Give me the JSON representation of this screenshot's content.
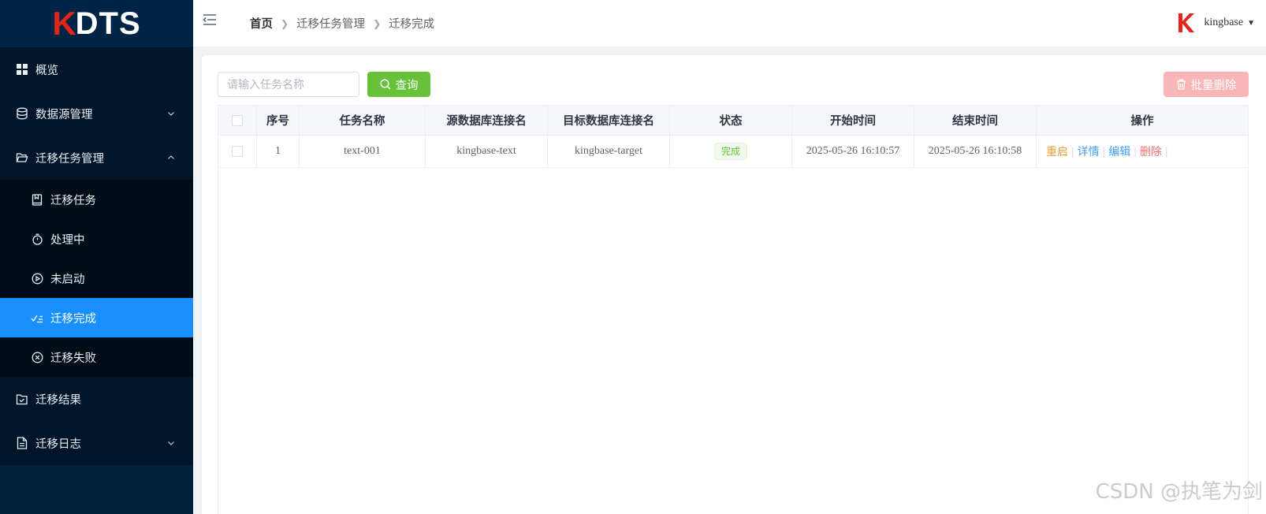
{
  "brand": {
    "logo_text": "DTS",
    "logo_mark": "K",
    "mark_color": "#e1251b"
  },
  "colors": {
    "sidebar_bg": "#001f3d",
    "active_menu": "#1890ff",
    "query_button": "#67c23a",
    "bulk_delete": "#fab6b6",
    "restart": "#e6a23c",
    "link": "#409eff",
    "danger": "#f56c6c"
  },
  "sidebar": {
    "items": [
      {
        "label": "概览",
        "icon": "grid-icon"
      },
      {
        "label": "数据源管理",
        "icon": "database-icon",
        "expandable": true,
        "expanded": false
      },
      {
        "label": "迁移任务管理",
        "icon": "folder-open-icon",
        "expandable": true,
        "expanded": true
      }
    ],
    "sub_items": [
      {
        "label": "迁移任务",
        "icon": "book-icon"
      },
      {
        "label": "处理中",
        "icon": "stopwatch-icon"
      },
      {
        "label": "未启动",
        "icon": "play-circle-icon"
      },
      {
        "label": "迁移完成",
        "icon": "check-list-icon",
        "active": true
      },
      {
        "label": "迁移失败",
        "icon": "close-circle-icon"
      }
    ],
    "bottom_items": [
      {
        "label": "迁移结果",
        "icon": "folder-check-icon"
      },
      {
        "label": "迁移日志",
        "icon": "document-icon",
        "expandable": true
      }
    ]
  },
  "header": {
    "breadcrumb": [
      "首页",
      "迁移任务管理",
      "迁移完成"
    ],
    "username": "kingbase"
  },
  "toolbar": {
    "search_placeholder": "请输入任务名称",
    "search_value": "",
    "query_label": "查询",
    "bulk_delete_label": "批量删除"
  },
  "table": {
    "columns": [
      "序号",
      "任务名称",
      "源数据库连接名",
      "目标数据库连接名",
      "状态",
      "开始时间",
      "结束时间",
      "操作"
    ],
    "rows": [
      {
        "index": "1",
        "name": "text-001",
        "source": "kingbase-text",
        "target": "kingbase-target",
        "status": "完成",
        "start": "2025-05-26 16:10:57",
        "end": "2025-05-26 16:10:58",
        "actions": [
          "重启",
          "详情",
          "编辑",
          "删除"
        ]
      }
    ]
  },
  "watermark": "CSDN @执笔为剑"
}
